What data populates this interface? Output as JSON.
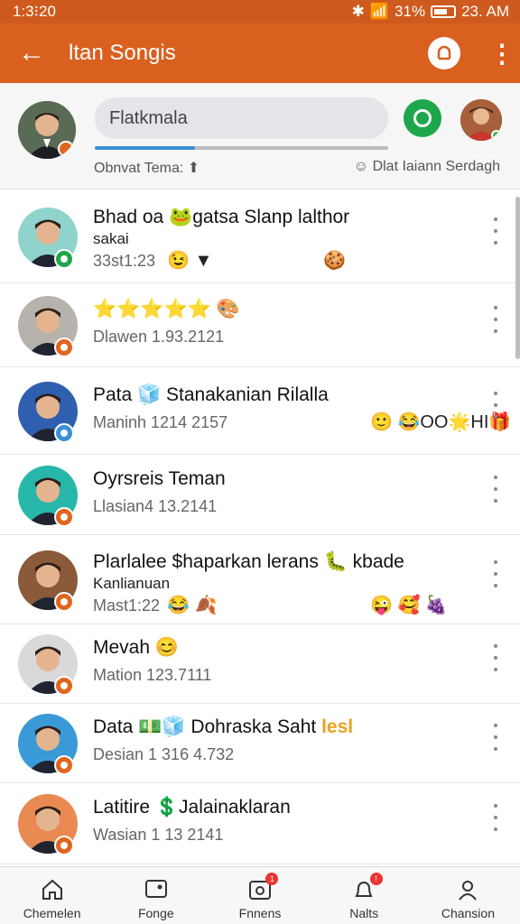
{
  "status_bar": {
    "time": "1:3⁝20",
    "battery": "31%",
    "clock_right": "23. AM"
  },
  "app_bar": {
    "title": "ltan Songis",
    "back_icon": "arrow-left-icon",
    "action_icon": "profile-circle-icon",
    "more_icon": "more-vertical-icon"
  },
  "top": {
    "search_value": "Flatkmala",
    "progress_fraction": 0.34,
    "meta_left": "Obnvat Tema: ⬆",
    "meta_right": "Dlat Iaiann Serdagh"
  },
  "contacts": [
    {
      "title": "Bhad oa 🐸gatsa Slanp lalthor",
      "subtitle": "sakai",
      "time": "33st1:23",
      "emoji_inline": "😉 ▼",
      "emoji_right": "🍪",
      "badge_color": "#1ea74a",
      "avatar_bg": "#8fd3cc"
    },
    {
      "title": "⭐⭐⭐⭐⭐ 🎨",
      "subtitle": "",
      "time": "Dlawen 1.93.2121",
      "emoji_inline": "",
      "emoji_right": "",
      "badge_color": "#e0661f",
      "avatar_bg": "#b7b2ab"
    },
    {
      "title": "Pata 🧊 Stanakanian Rilalla",
      "subtitle": "",
      "time": "Maninh 1214 2157",
      "emoji_inline": "",
      "emoji_right": "🙂 😂OO🌟HI🎁",
      "badge_color": "#3a8fd6",
      "avatar_bg": "#2f5fae"
    },
    {
      "title": "Oyrsreis Teman",
      "subtitle": "",
      "time": "Llasian4 13.2141",
      "emoji_inline": "",
      "emoji_right": "",
      "badge_color": "#e0661f",
      "avatar_bg": "#27b7a8"
    },
    {
      "title": "Plarlalee $haparkan lerans 🐛 kbade",
      "subtitle": "Kanlianuan",
      "time": "Mast1:22",
      "emoji_inline": "😂 🍂",
      "emoji_right": "😜 🥰 🍇",
      "badge_color": "#e0661f",
      "avatar_bg": "#8a5a3a"
    },
    {
      "title": "Mevah 😊",
      "subtitle": "",
      "time": "Mation 123.7111",
      "emoji_inline": "",
      "emoji_right": "",
      "badge_color": "#e0661f",
      "avatar_bg": "#d9d9d9"
    },
    {
      "title": "Data 💵🧊 Dohraska Saht",
      "title_accent": "lesl",
      "subtitle": "",
      "time": "Desian 1 316 4.732",
      "emoji_inline": "",
      "emoji_right": "",
      "badge_color": "#e0661f",
      "avatar_bg": "#3a9ad8"
    },
    {
      "title": "Latitire 💲Jalainaklaran",
      "subtitle": "",
      "time": "Wasian 1 13 2141",
      "emoji_inline": "",
      "emoji_right": "",
      "badge_color": "#e0661f",
      "avatar_bg": "#e98a52"
    }
  ],
  "bottom_nav": [
    {
      "label": "Chemelen",
      "icon": "home-icon",
      "badge": ""
    },
    {
      "label": "Fonge",
      "icon": "chat-icon",
      "badge": ""
    },
    {
      "label": "Fnnens",
      "icon": "camera-icon",
      "badge": "1"
    },
    {
      "label": "Nalts",
      "icon": "bell-icon",
      "badge": "!"
    },
    {
      "label": "Chansion",
      "icon": "person-icon",
      "badge": ""
    }
  ],
  "colors": {
    "primary": "#d9601f",
    "status_bar": "#cf5a1d",
    "accent_green": "#1ea74a",
    "progress_blue": "#3a8fd6"
  }
}
